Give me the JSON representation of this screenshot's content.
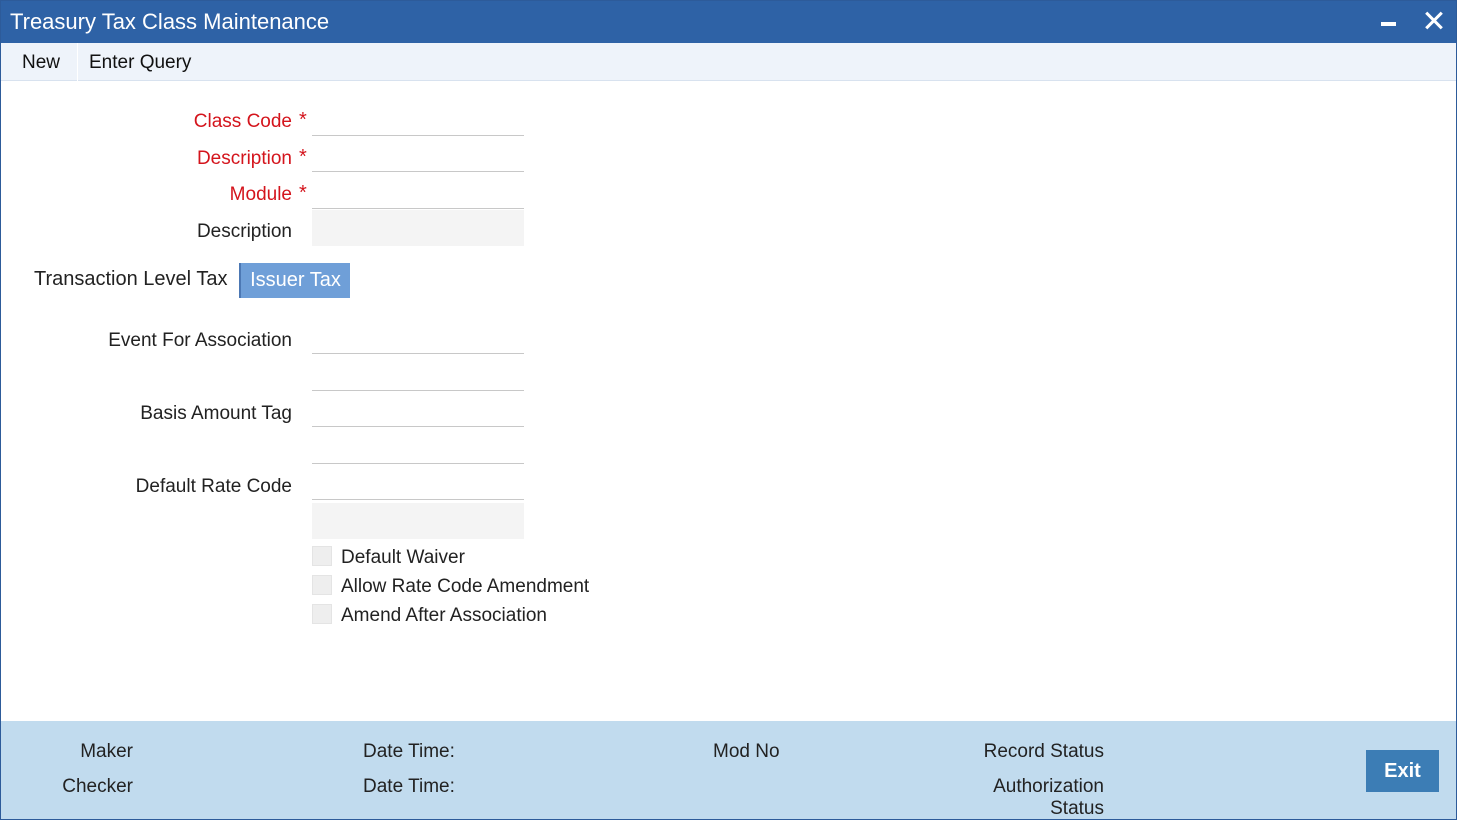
{
  "window": {
    "title": "Treasury Tax Class Maintenance"
  },
  "toolbar": {
    "new_label": "New",
    "enter_query_label": "Enter Query"
  },
  "form": {
    "class_code_label": "Class Code",
    "description_label": "Description",
    "module_label": "Module",
    "module_description_label": "Description",
    "required_marker": "*",
    "class_code_value": "",
    "description_value": "",
    "module_value": "",
    "module_description_value": ""
  },
  "tabs": {
    "transaction_level_tax": "Transaction Level Tax",
    "issuer_tax": "Issuer Tax"
  },
  "issuer_tax": {
    "event_label": "Event For Association",
    "basis_amount_label": "Basis Amount Tag",
    "default_rate_label": "Default Rate Code",
    "checkboxes": {
      "default_waiver": "Default Waiver",
      "allow_rate_code_amendment": "Allow Rate Code Amendment",
      "amend_after_association": "Amend After Association"
    }
  },
  "footer": {
    "maker_label": "Maker",
    "checker_label": "Checker",
    "date_time_label": "Date Time:",
    "mod_no_label": "Mod No",
    "record_status_label": "Record Status",
    "authorization_label": "Authorization",
    "status_label": "Status",
    "exit_label": "Exit"
  },
  "colors": {
    "title_bar": "#2e62a6",
    "required": "#d4141c",
    "active_tab": "#6f9fd8",
    "footer": "#c1dbee",
    "exit_button": "#3c7db5"
  }
}
